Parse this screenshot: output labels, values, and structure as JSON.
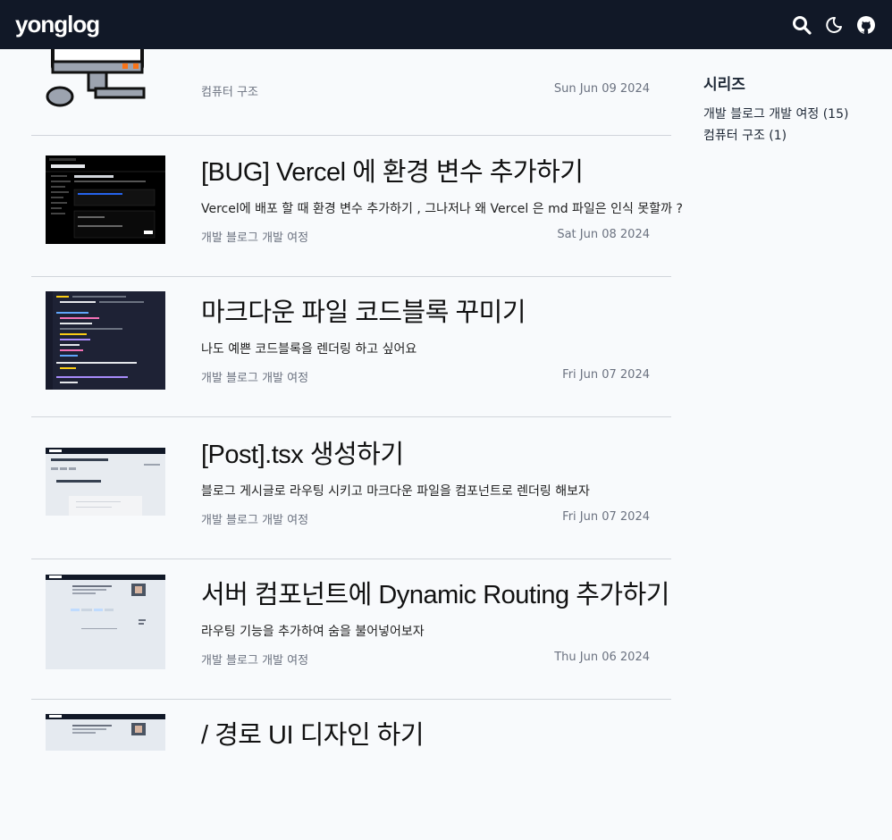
{
  "header": {
    "logo": "yonglog",
    "icons": [
      "search-icon",
      "moon-icon",
      "github-icon"
    ]
  },
  "posts": [
    {
      "title": "",
      "desc": "",
      "category": "컴퓨터 구조",
      "date": "Sun Jun 09 2024",
      "thumb": "computer-illustration"
    },
    {
      "title": "[BUG] Vercel 에 환경 변수 추가하기",
      "desc": "Vercel에 배포 할 때 환경 변수 추가하기 , 그나저나 왜 Vercel 은 md 파일은 인식 못할까 ?",
      "category": "개발 블로그 개발 여정",
      "date": "Sat Jun 08 2024",
      "thumb": "vercel-settings-screenshot"
    },
    {
      "title": "마크다운 파일 코드블록 꾸미기",
      "desc": "나도 예쁜 코드블록을 렌더링 하고 싶어요",
      "category": "개발 블로그 개발 여정",
      "date": "Fri Jun 07 2024",
      "thumb": "code-editor-screenshot"
    },
    {
      "title": "[Post].tsx 생성하기",
      "desc": "블로그 게시글로 라우팅 시키고 마크다운 파일을 컴포넌트로 렌더링 해보자",
      "category": "개발 블로그 개발 여정",
      "date": "Fri Jun 07 2024",
      "thumb": "blog-post-screenshot"
    },
    {
      "title": "서버 컴포넌트에 Dynamic Routing 추가하기",
      "desc": "라우팅 기능을 추가하여 숨을 불어넣어보자",
      "category": "개발 블로그 개발 여정",
      "date": "Thu Jun 06 2024",
      "thumb": "blog-home-screenshot"
    },
    {
      "title": "/ 경로 UI 디자인 하기",
      "desc": "",
      "category": "",
      "date": "",
      "thumb": "blog-home-screenshot"
    }
  ],
  "sidebar": {
    "title": "시리즈",
    "series": [
      {
        "label": "개발 블로그 개발 여정 (15)"
      },
      {
        "label": "컴퓨터 구조 (1)"
      }
    ]
  },
  "colors": {
    "header_bg": "#111827",
    "page_bg": "#f8fafc",
    "meta_text": "#6b7280"
  }
}
